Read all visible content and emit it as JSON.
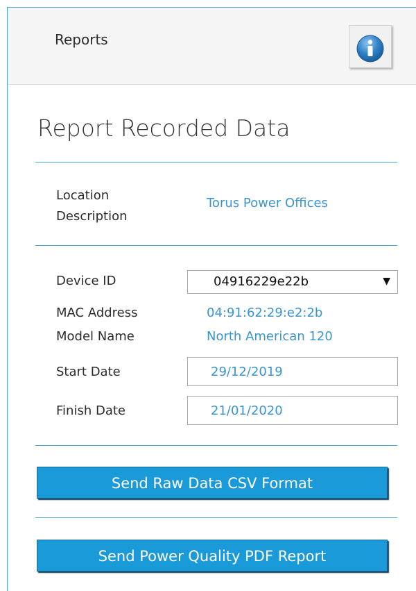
{
  "header": {
    "title": "Reports",
    "info_icon": "info-icon"
  },
  "page": {
    "title": "Report Recorded Data"
  },
  "location": {
    "label_line1": "Location",
    "label_line2": "Description",
    "value": "Torus Power Offices"
  },
  "device": {
    "id_label": "Device ID",
    "id_value": "04916229e22b",
    "mac_label": "MAC Address",
    "mac_value": "04:91:62:29:e2:2b",
    "model_label": "Model Name",
    "model_value": "North American 120"
  },
  "dates": {
    "start_label": "Start Date",
    "start_value": "29/12/2019",
    "finish_label": "Finish Date",
    "finish_value": "21/01/2020"
  },
  "actions": {
    "csv_label": "Send Raw Data CSV Format",
    "pdf_label": "Send Power Quality PDF Report"
  },
  "colors": {
    "accent": "#4aa8d8",
    "button": "#1a9ad8",
    "link_text": "#3a94d0"
  }
}
